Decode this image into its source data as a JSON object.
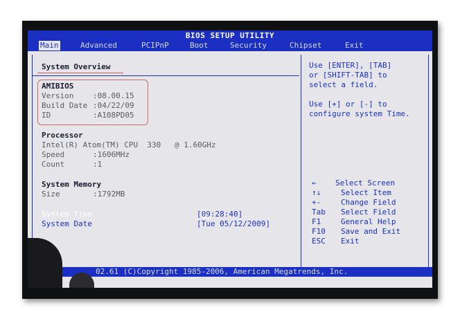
{
  "title": "BIOS SETUP UTILITY",
  "menu": [
    "Main",
    "Advanced",
    "PCIPnP",
    "Boot",
    "Security",
    "Chipset",
    "Exit"
  ],
  "section_title": "System Overview",
  "amibios": {
    "heading": "AMIBIOS",
    "version_label": "Version",
    "version_value": ":08.00.15",
    "build_label": "Build Date",
    "build_value": ":04/22/09",
    "id_label": "ID",
    "id_value": ":A108PD05"
  },
  "processor": {
    "heading": "Processor",
    "model": "Intel(R) Atom(TM) CPU  330   @ 1.60GHz",
    "speed_label": "Speed",
    "speed_value": ":1606MHz",
    "count_label": "Count",
    "count_value": ":1"
  },
  "memory": {
    "heading": "System Memory",
    "size_label": "Size",
    "size_value": ":1792MB"
  },
  "system_time": {
    "label": "System Time",
    "value_prefix": "[",
    "value_highlight": "09",
    "value_rest": ":28:40]"
  },
  "system_date": {
    "label": "System Date",
    "value": "[Tue 05/12/2009]"
  },
  "help": {
    "line1": "Use [ENTER], [TAB]",
    "line2": "or [SHIFT-TAB] to",
    "line3": "select a field.",
    "line4": "Use [+] or [-] to",
    "line5": "configure system Time."
  },
  "keys": [
    {
      "key": "←",
      "action": "Select Screen"
    },
    {
      "key": "↑↓",
      "action": "Select Item"
    },
    {
      "key": "+-",
      "action": "Change Field"
    },
    {
      "key": "Tab",
      "action": "Select Field"
    },
    {
      "key": "F1",
      "action": "General Help"
    },
    {
      "key": "F10",
      "action": "Save and Exit"
    },
    {
      "key": "ESC",
      "action": "Exit"
    }
  ],
  "footer": "02.61 (C)Copyright 1985-2006, American Megatrends, Inc."
}
